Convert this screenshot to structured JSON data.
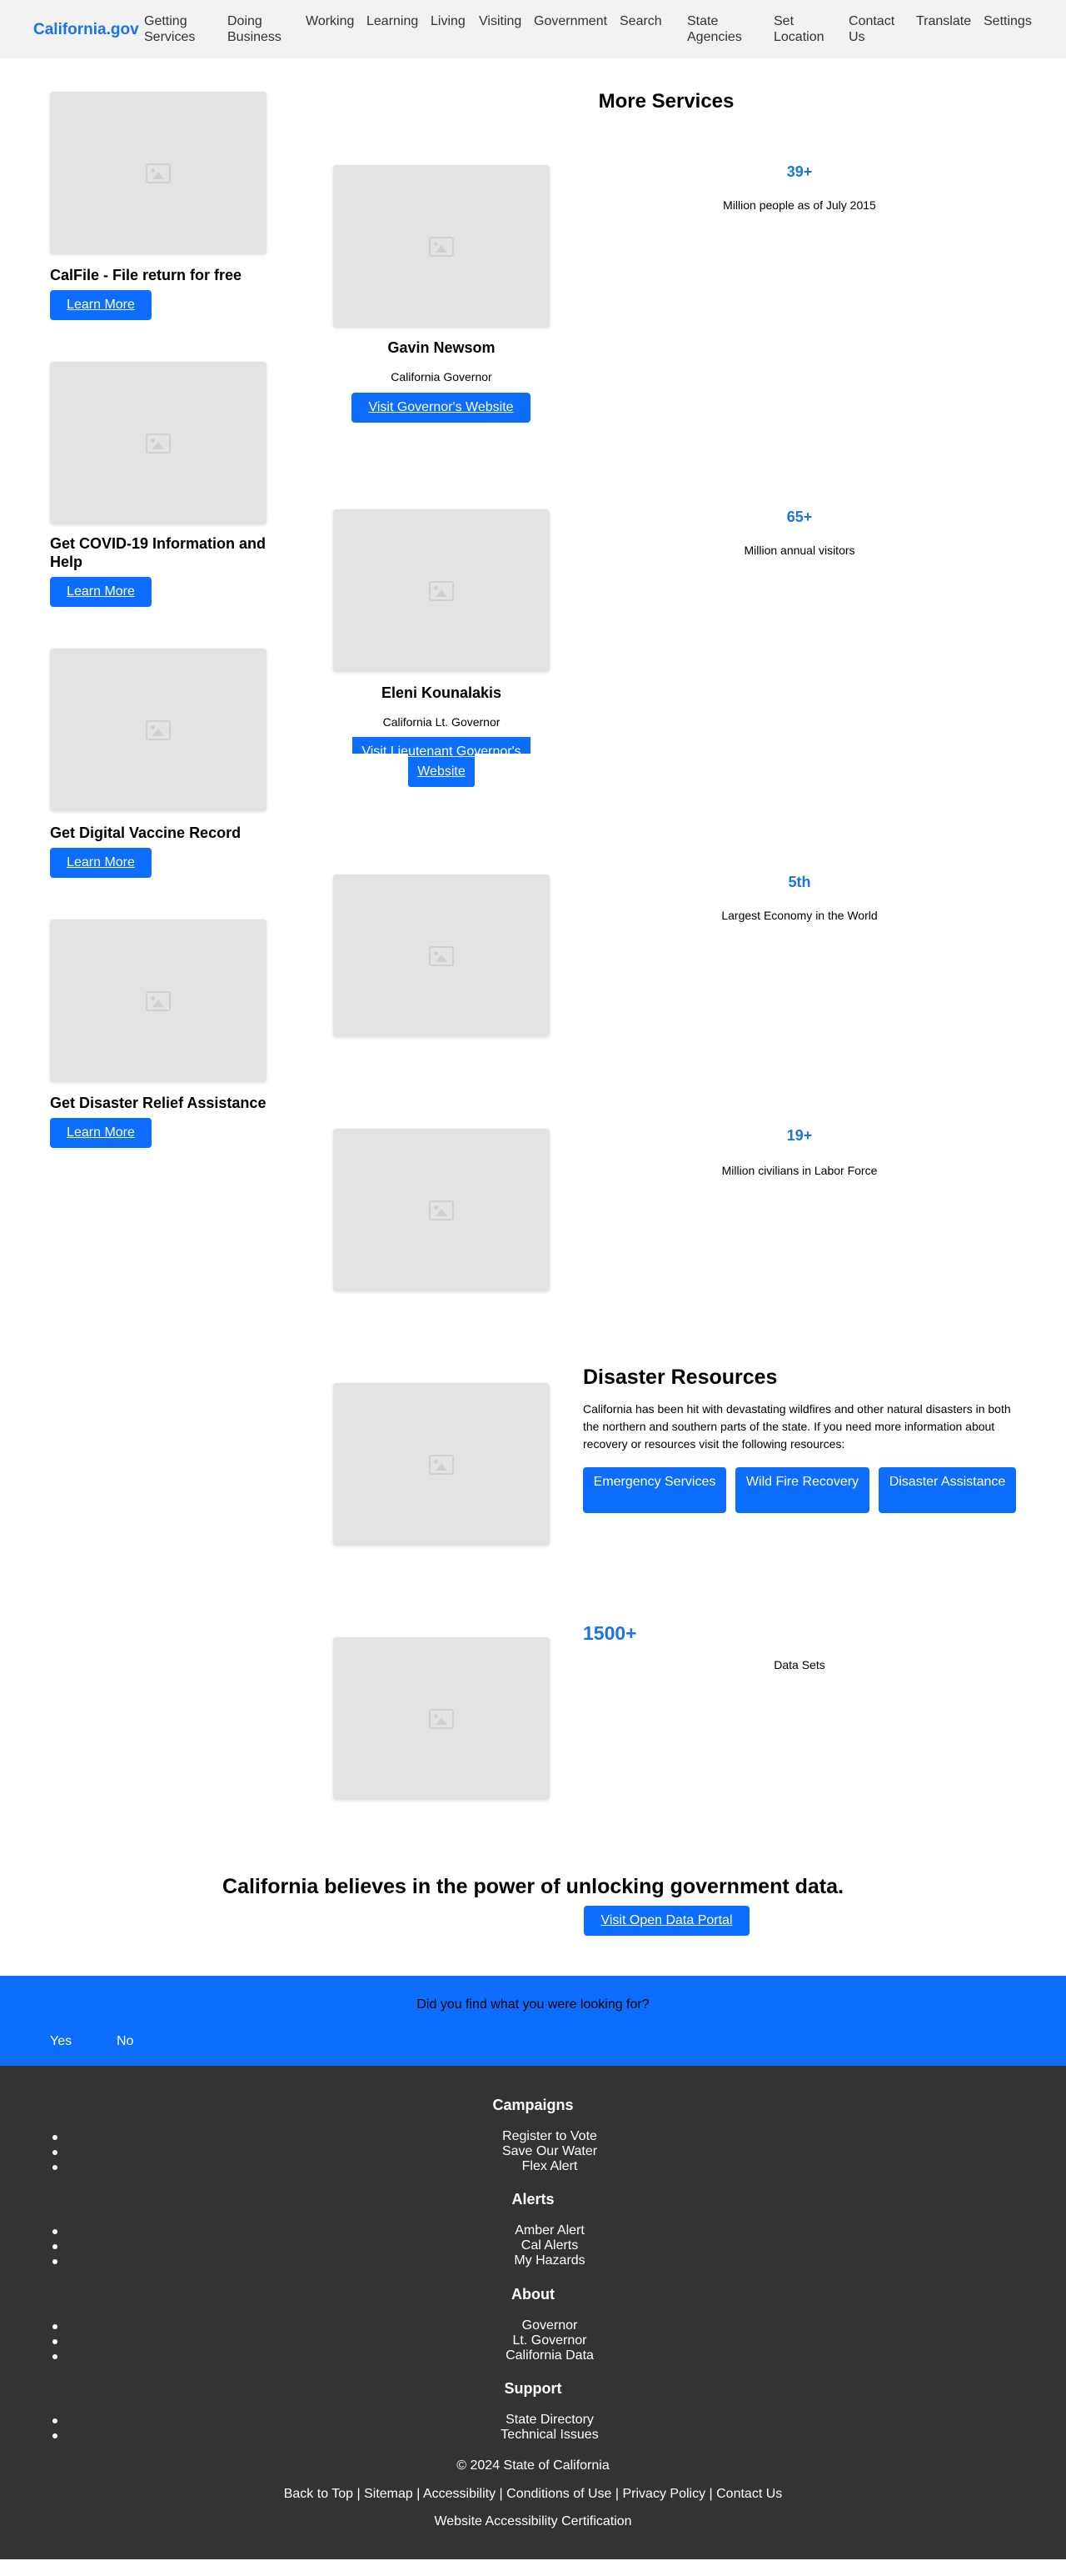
{
  "header": {
    "logo": "California.gov",
    "nav": [
      "Getting Services",
      "Doing Business",
      "Working",
      "Learning",
      "Living",
      "Visiting",
      "Government",
      "Search",
      "State Agencies",
      "Set Location",
      "Contact Us",
      "Translate",
      "Settings"
    ]
  },
  "services": [
    {
      "title": "CalFile - File return for free",
      "button": "Learn More"
    },
    {
      "title": "Get COVID-19 Information and Help",
      "button": "Learn More"
    },
    {
      "title": "Get Digital Vaccine Record",
      "button": "Learn More"
    },
    {
      "title": "Get Disaster Relief Assistance",
      "button": "Learn More"
    }
  ],
  "more_services": {
    "title": "More Services"
  },
  "people": [
    {
      "name": "Gavin Newsom",
      "role": "California Governor",
      "button": "Visit Governor's Website"
    },
    {
      "name": "Eleni Kounalakis",
      "role": "California Lt. Governor",
      "button": "Visit Lieutenant Governor's Website"
    }
  ],
  "stats": [
    {
      "value": "39+",
      "label": "Million people as of July 2015"
    },
    {
      "value": "65+",
      "label": "Million annual visitors"
    },
    {
      "value": "5th",
      "label": "Largest Economy in the World"
    },
    {
      "value": "19+",
      "label": "Million civilians in Labor Force"
    }
  ],
  "disaster": {
    "title": "Disaster Resources",
    "text": "California has been hit with devastating wildfires and other natural disasters in both the northern and southern parts of the state. If you need more information about recovery or resources visit the following resources:",
    "buttons": [
      "Emergency Services",
      "Wild Fire Recovery",
      "Disaster Assistance"
    ]
  },
  "data_sets": {
    "value": "1500+",
    "label": "Data Sets"
  },
  "open_data": {
    "heading": "California believes in the power of unlocking government data.",
    "button": "Visit Open Data Portal"
  },
  "feedback": {
    "question": "Did you find what you were looking for?",
    "yes": "Yes",
    "no": "No"
  },
  "footer": {
    "sections": [
      {
        "title": "Campaigns",
        "items": [
          "Register to Vote",
          "Save Our Water",
          "Flex Alert"
        ]
      },
      {
        "title": "Alerts",
        "items": [
          "Amber Alert",
          "Cal Alerts",
          "My Hazards"
        ]
      },
      {
        "title": "About",
        "items": [
          "Governor",
          "Lt. Governor",
          "California Data"
        ]
      },
      {
        "title": "Support",
        "items": [
          "State Directory",
          "Technical Issues"
        ]
      }
    ],
    "copyright": "© 2024 State of California",
    "links": [
      "Back to Top",
      "Sitemap",
      "Accessibility",
      "Conditions of Use",
      "Privacy Policy",
      "Contact Us"
    ],
    "link_separator": " | ",
    "certification": "Website Accessibility Certification"
  }
}
